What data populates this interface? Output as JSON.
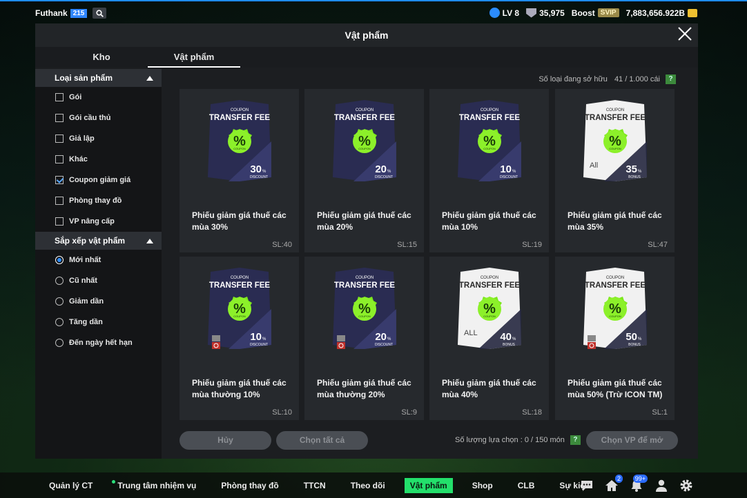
{
  "topbar": {
    "username": "Futhank",
    "user_num": "215",
    "level": "LV 8",
    "rating": "35,975",
    "boost_label": "Boost",
    "svip_label": "SVIP",
    "coins": "7,883,656.922B"
  },
  "window": {
    "title": "Vật phẩm"
  },
  "tabs": [
    {
      "label": "Kho"
    },
    {
      "label": "Vật phẩm"
    }
  ],
  "sidebar": {
    "section1": {
      "title": "Loại sản phẩm",
      "items": [
        {
          "label": "Gói",
          "checked": false
        },
        {
          "label": "Gói cầu thủ",
          "checked": false
        },
        {
          "label": "Giả lập",
          "checked": false
        },
        {
          "label": "Khác",
          "checked": false
        },
        {
          "label": "Coupon giảm giá",
          "checked": true
        },
        {
          "label": "Phòng thay đồ",
          "checked": false
        },
        {
          "label": "VP nâng cấp",
          "checked": false
        }
      ]
    },
    "section2": {
      "title": "Sắp xếp vật phẩm",
      "items": [
        {
          "label": "Mới nhất",
          "selected": true
        },
        {
          "label": "Cũ nhất",
          "selected": false
        },
        {
          "label": "Giảm dần",
          "selected": false
        },
        {
          "label": "Tăng dần",
          "selected": false
        },
        {
          "label": "Đến ngày hết hạn",
          "selected": false
        }
      ]
    }
  },
  "owned": {
    "label": "Số loại đang sở hữu",
    "value": "41 / 1.000 cái",
    "help": "?"
  },
  "coupon_text": {
    "small": "COUPON",
    "big": "TRANSFER FEE",
    "badge": "COUPON",
    "pct": "%"
  },
  "items": [
    {
      "name": "Phiếu giảm giá thuế các mùa 30%",
      "qty": "SL:40",
      "value": "30",
      "sub": "DISCOUNT",
      "style": "dark",
      "class_text": "",
      "restricted": false
    },
    {
      "name": "Phiếu giảm giá thuế các mùa 20%",
      "qty": "SL:15",
      "value": "20",
      "sub": "DISCOUNT",
      "style": "dark",
      "class_text": "",
      "restricted": false
    },
    {
      "name": "Phiếu giảm giá thuế các mùa 10%",
      "qty": "SL:19",
      "value": "10",
      "sub": "DISCOUNT",
      "style": "dark",
      "class_text": "",
      "restricted": false
    },
    {
      "name": "Phiếu giảm giá thuế các mùa 35%",
      "qty": "SL:47",
      "value": "35",
      "sub": "BONUS",
      "style": "white",
      "class_text": "All",
      "restricted": false
    },
    {
      "name": "Phiếu giảm giá thuế các mùa thường 10%",
      "qty": "SL:10",
      "value": "10",
      "sub": "DISCOUNT",
      "style": "dark",
      "class_text": "",
      "restricted": true
    },
    {
      "name": "Phiếu giảm giá thuế các mùa thường 20%",
      "qty": "SL:9",
      "value": "20",
      "sub": "DISCOUNT",
      "style": "dark",
      "class_text": "",
      "restricted": true
    },
    {
      "name": "Phiếu giảm giá thuế các mùa 40%",
      "qty": "SL:18",
      "value": "40",
      "sub": "BONUS",
      "style": "white",
      "class_text": "ALL",
      "restricted": false
    },
    {
      "name": "Phiếu giảm giá thuế các mùa 50% (Trừ ICON TM)",
      "qty": "SL:1",
      "value": "50",
      "sub": "BONUS",
      "style": "white",
      "class_text": "",
      "restricted": true
    }
  ],
  "actions": {
    "cancel": "Hủy",
    "select_all": "Chọn tất cả",
    "select_count_label": "Số lượng lựa chọn : 0 / 150 món",
    "help": "?",
    "open": "Chọn VP để mở"
  },
  "navbar": {
    "items": [
      {
        "label": "Quản lý CT",
        "active": false
      },
      {
        "label": "Trung tâm nhiệm vụ",
        "active": false
      },
      {
        "label": "Phòng thay đồ",
        "active": false
      },
      {
        "label": "TTCN",
        "active": false
      },
      {
        "label": "Theo dõi",
        "active": false
      },
      {
        "label": "Vật phẩm",
        "active": true
      },
      {
        "label": "Shop",
        "active": false
      },
      {
        "label": "CLB",
        "active": false
      },
      {
        "label": "Sự kiện",
        "active": false
      }
    ],
    "home_badge": "2",
    "bell_badge": "99+"
  },
  "colors": {
    "accent_green": "#23e06b",
    "blue": "#2b8cff",
    "coupon_green": "#7ce81c"
  }
}
